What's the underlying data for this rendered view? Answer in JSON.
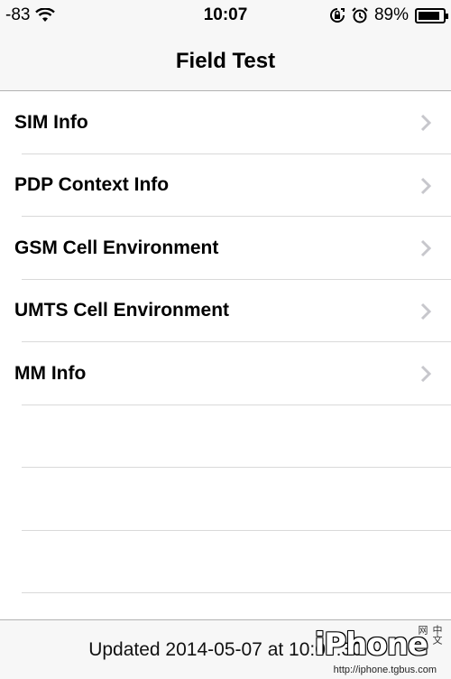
{
  "status_bar": {
    "signal": "-83",
    "time": "10:07",
    "battery": "89%"
  },
  "nav": {
    "title": "Field Test"
  },
  "menu": {
    "items": [
      {
        "label": "SIM Info"
      },
      {
        "label": "PDP Context Info"
      },
      {
        "label": "GSM Cell Environment"
      },
      {
        "label": "UMTS Cell Environment"
      },
      {
        "label": "MM Info"
      }
    ]
  },
  "toolbar": {
    "updated": "Updated 2014-05-07 at 10:07:30"
  },
  "watermark": {
    "logo": "iPhone",
    "chinese": "中文网",
    "url": "http://iphone.tgbus.com"
  },
  "icons": [
    "wifi-icon",
    "rotation-lock-icon",
    "alarm-icon",
    "battery-icon",
    "chevron-right-icon"
  ]
}
